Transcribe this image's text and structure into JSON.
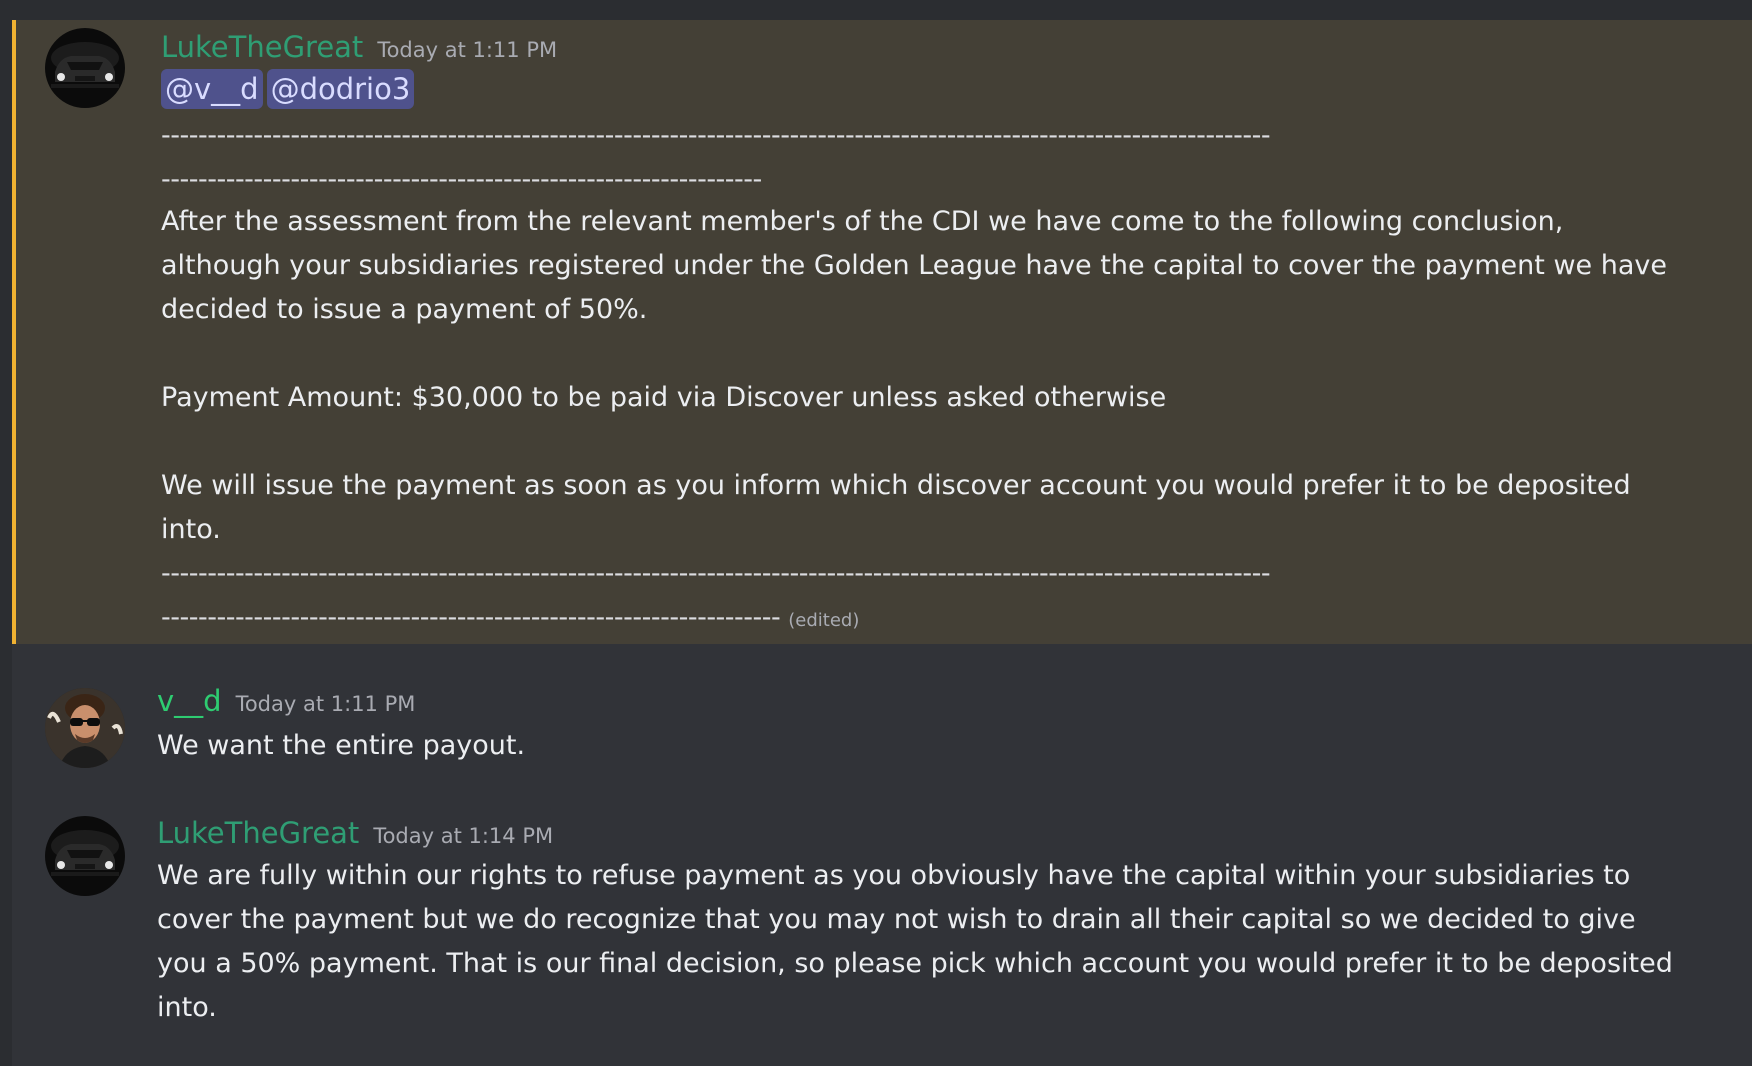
{
  "colors": {
    "background": "#313338",
    "highlight_background": "#444036",
    "highlight_bar": "#f0b232",
    "username_luke": "#2f9e74",
    "username_vd": "#2ecc71",
    "mention_background": "#4f528c",
    "text": "#eceef1",
    "muted": "#a9abb2"
  },
  "messages": [
    {
      "author": "LukeTheGreat",
      "timestamp": "Today at 1:11 PM",
      "mentions": [
        "@v__d",
        "@dodrio3"
      ],
      "divider_top_1": "------------------------------------------------------------------------------------------------------------------------",
      "divider_top_2": "-----------------------------------------------------------------",
      "paragraph_1": "After the assessment from the relevant member's of the CDI we have come to the following conclusion, although your subsidiaries registered under the Golden League have the capital to cover the payment we have decided to issue a payment of 50%.",
      "paragraph_2": "Payment Amount: $30,000 to be paid via Discover unless asked otherwise",
      "paragraph_3": "We will issue the payment as soon as you inform which discover account you would prefer it to be deposited into.",
      "divider_bottom_1": "------------------------------------------------------------------------------------------------------------------------",
      "divider_bottom_2": "-------------------------------------------------------------------",
      "edited_label": "(edited)",
      "avatar_icon": "car-avatar-icon"
    },
    {
      "author": "v__d",
      "timestamp": "Today at 1:11 PM",
      "text": "We want the entire payout.",
      "avatar_icon": "person-sunglasses-avatar-icon"
    },
    {
      "author": "LukeTheGreat",
      "timestamp": "Today at 1:14 PM",
      "text": "We are fully within our rights to refuse payment as you obviously have the capital within your subsidiaries to cover the payment but we do recognize that you may not wish to drain all their capital so we decided to give you a 50% payment. That is our final decision, so please pick which account you would prefer it to be deposited into.",
      "avatar_icon": "car-avatar-icon"
    }
  ]
}
